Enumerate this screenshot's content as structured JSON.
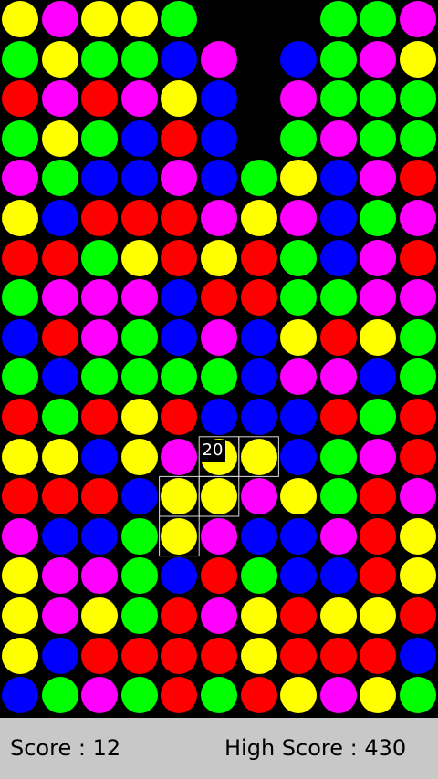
{
  "colors": {
    "R": "#ff0000",
    "G": "#00ff00",
    "B": "#0000ff",
    "Y": "#ffff00",
    "M": "#ff00ff"
  },
  "grid": [
    "YMYYG..GGM",
    "GYGGBM.BGMY",
    "RMRMYB.MGGG",
    "GYGBRB.GMGG",
    "MGBBMBGYBMR",
    "YBRRRMYMBGM",
    "RRGYRYRGBMR",
    "GMMMBRRGGMM",
    "BRMGBMBYRYG",
    "GBGGGGBMMBG",
    "RGRYRBBBRGR",
    "YYBYMYYBGMR",
    "RRRBYYMYGRM",
    "MBBGYMBBMRY",
    "YMMGBRGBBRY",
    "YMYGRMYRYYR",
    "YBRRRRYRRRB",
    "BGMGRGRYMYG"
  ],
  "selection": {
    "cells": [
      [
        11,
        5
      ],
      [
        11,
        6
      ],
      [
        12,
        4
      ],
      [
        12,
        5
      ],
      [
        13,
        4
      ]
    ],
    "combo_points": "20"
  },
  "status": {
    "score": "Score : 12",
    "high_score": "High Score : 430"
  }
}
